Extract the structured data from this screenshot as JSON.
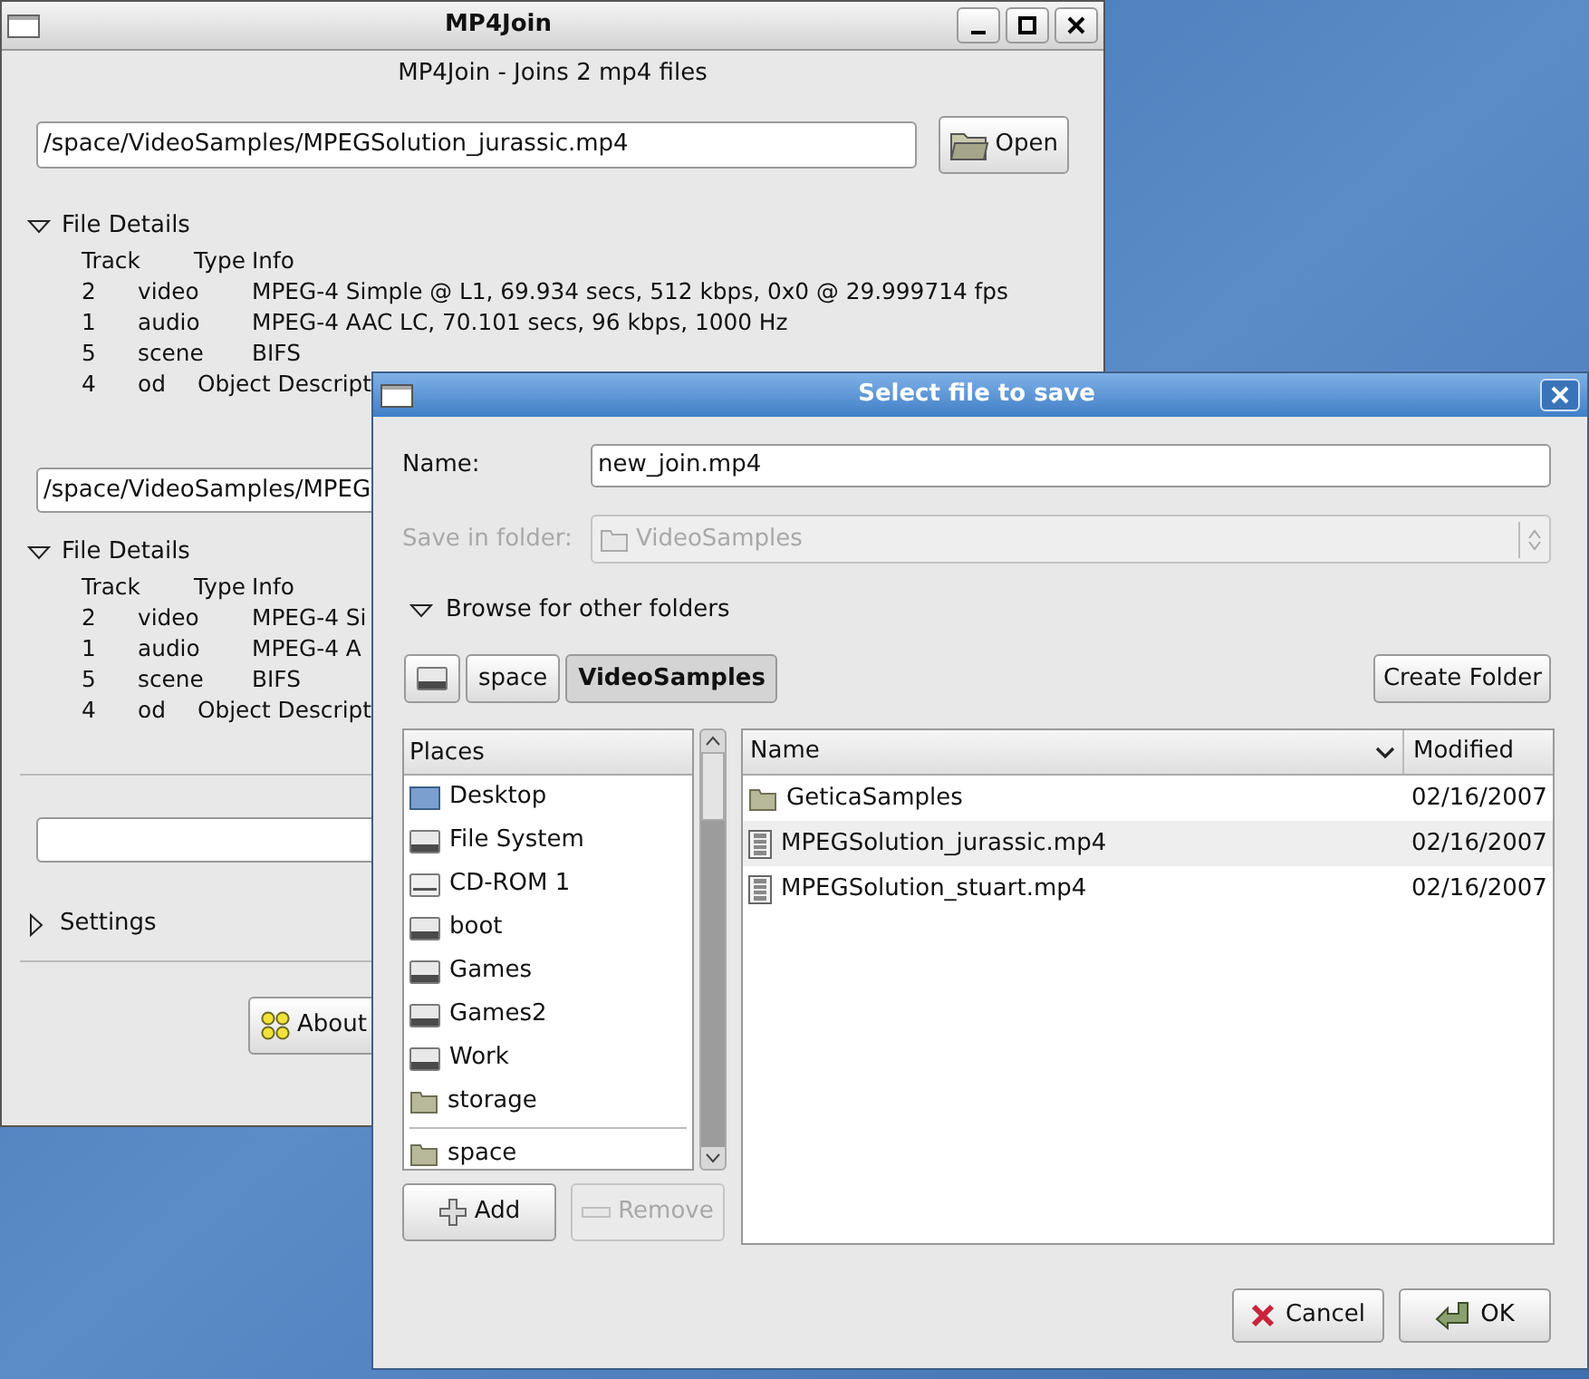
{
  "main_window": {
    "title": "MP4Join",
    "subtitle": "MP4Join - Joins 2 mp4 files",
    "files": [
      {
        "path": "/space/VideoSamples/MPEGSolution_jurassic.mp4",
        "open_button": "Open",
        "details": {
          "label": "File Details",
          "expanded": true,
          "columns": [
            "Track",
            "Type",
            "Info"
          ],
          "rows": [
            [
              "2",
              "video",
              "MPEG-4 Simple @ L1, 69.934 secs, 512 kbps, 0x0 @ 29.999714 fps"
            ],
            [
              "1",
              "audio",
              "MPEG-4 AAC LC, 70.101 secs, 96 kbps, 1000 Hz"
            ],
            [
              "5",
              "scene",
              "BIFS"
            ],
            [
              "4",
              "od",
              "Object Descript"
            ]
          ]
        }
      },
      {
        "path": "/space/VideoSamples/MPEG",
        "details": {
          "label": "File Details",
          "expanded": true,
          "columns": [
            "Track",
            "Type",
            "Info"
          ],
          "rows": [
            [
              "2",
              "video",
              "MPEG-4 Si"
            ],
            [
              "1",
              "audio",
              "MPEG-4 A"
            ],
            [
              "5",
              "scene",
              "BIFS"
            ],
            [
              "4",
              "od",
              "Object Descript"
            ]
          ]
        }
      }
    ],
    "settings": {
      "label": "Settings",
      "expanded": false
    },
    "about_button": "About"
  },
  "dialog": {
    "title": "Select file to save",
    "name_label": "Name:",
    "name_value": "new_join.mp4",
    "folder_label": "Save in folder:",
    "folder_value": "VideoSamples",
    "folder_disabled": true,
    "browse": {
      "label": "Browse for other folders",
      "expanded": true
    },
    "path_buttons": [
      {
        "kind": "drive",
        "selected": false
      },
      {
        "kind": "folder",
        "label": "space",
        "selected": false
      },
      {
        "kind": "folder",
        "label": "VideoSamples",
        "selected": true
      }
    ],
    "create_folder": "Create Folder",
    "places": {
      "header": "Places",
      "devices": [
        {
          "label": "Desktop",
          "kind": "desktop"
        },
        {
          "label": "File System",
          "kind": "drive"
        },
        {
          "label": "CD-ROM 1",
          "kind": "cdrom"
        },
        {
          "label": "boot",
          "kind": "drive"
        },
        {
          "label": "Games",
          "kind": "drive"
        },
        {
          "label": "Games2",
          "kind": "drive"
        },
        {
          "label": "Work",
          "kind": "drive"
        },
        {
          "label": "storage",
          "kind": "share"
        }
      ],
      "bookmarks": [
        {
          "label": "space",
          "kind": "folder"
        }
      ]
    },
    "place_buttons": [
      {
        "label": "Add",
        "kind": "add",
        "disabled": false
      },
      {
        "label": "Remove",
        "kind": "remove",
        "disabled": true
      }
    ],
    "file_list": {
      "columns": [
        "Name",
        "Modified"
      ],
      "rows": [
        {
          "name": "GeticaSamples",
          "modified": "02/16/2007",
          "kind": "folder"
        },
        {
          "name": "MPEGSolution_jurassic.mp4",
          "modified": "02/16/2007",
          "kind": "video"
        },
        {
          "name": "MPEGSolution_stuart.mp4",
          "modified": "02/16/2007",
          "kind": "video"
        }
      ]
    },
    "buttons": [
      {
        "label": "Cancel",
        "kind": "cancel"
      },
      {
        "label": "OK",
        "kind": "ok"
      }
    ]
  }
}
